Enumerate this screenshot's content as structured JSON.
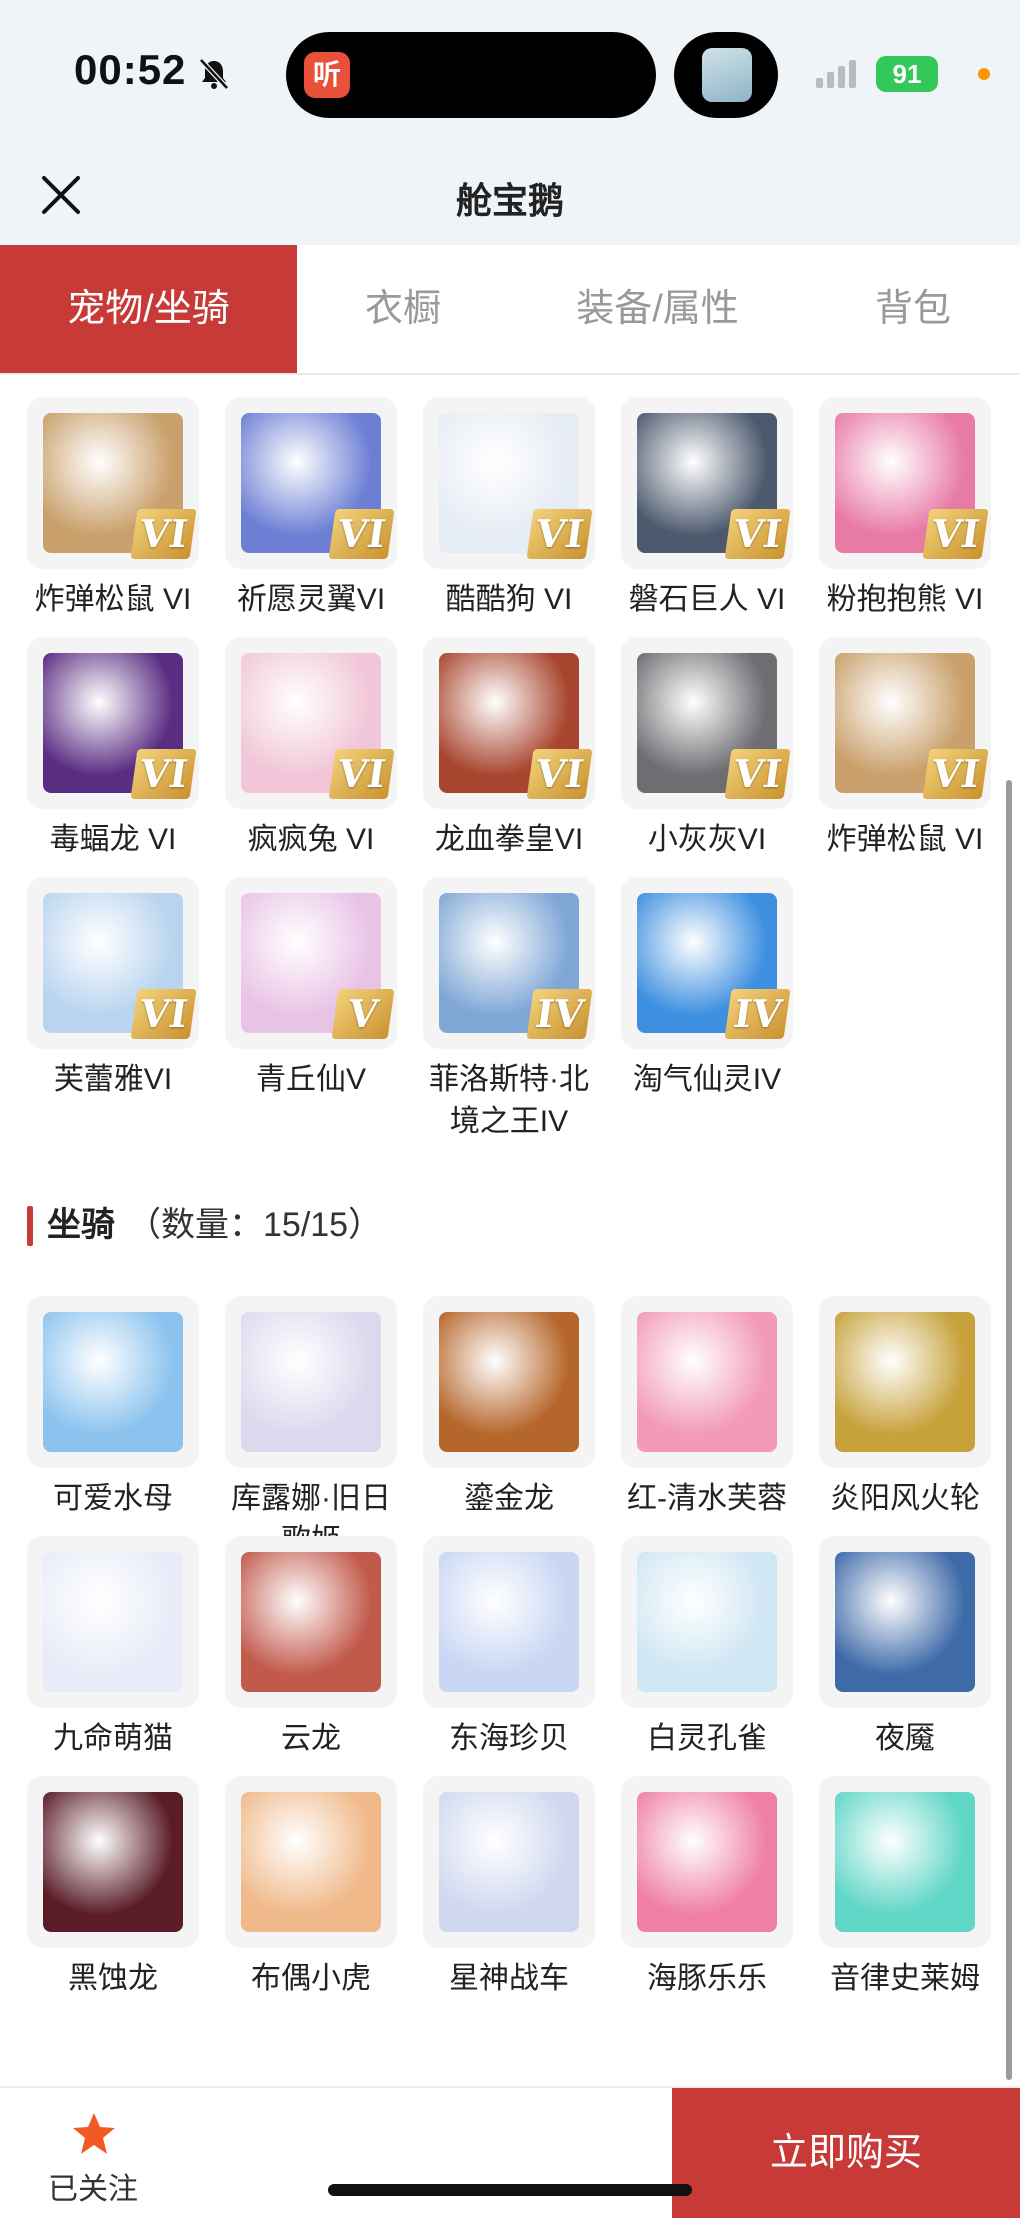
{
  "status": {
    "time": "00:52",
    "island_app": "听",
    "battery": "91"
  },
  "nav": {
    "title": "舱宝鹅"
  },
  "tabs": [
    {
      "label": "宠物/坐骑"
    },
    {
      "label": "衣橱"
    },
    {
      "label": "装备/属性"
    },
    {
      "label": "背包"
    }
  ],
  "pets": [
    {
      "name": "炸弹松鼠 VI",
      "badge": "VI",
      "color": "#c9a06b"
    },
    {
      "name": "祈愿灵翼VI",
      "badge": "VI",
      "color": "#6c7fd4"
    },
    {
      "name": "酷酷狗 VI",
      "badge": "VI",
      "color": "#e6ecf4"
    },
    {
      "name": "磐石巨人 VI",
      "badge": "VI",
      "color": "#4d5a6e"
    },
    {
      "name": "粉抱抱熊 VI",
      "badge": "VI",
      "color": "#e87aa6"
    },
    {
      "name": "毒蝠龙 VI",
      "badge": "VI",
      "color": "#5a2d82"
    },
    {
      "name": "疯疯兔 VI",
      "badge": "VI",
      "color": "#f2c6d8"
    },
    {
      "name": "龙血拳皇VI",
      "badge": "VI",
      "color": "#a8452e"
    },
    {
      "name": "小灰灰VI",
      "badge": "VI",
      "color": "#6d6d72"
    },
    {
      "name": "炸弹松鼠 VI",
      "badge": "VI",
      "color": "#c9a06b"
    },
    {
      "name": "芙蕾雅VI",
      "badge": "VI",
      "color": "#b9d4ef"
    },
    {
      "name": "青丘仙V",
      "badge": "V",
      "color": "#e9c3e6"
    },
    {
      "name": "菲洛斯特·北境之王IV",
      "badge": "IV",
      "color": "#7fa7d6"
    },
    {
      "name": "淘气仙灵IV",
      "badge": "IV",
      "color": "#3d8fe0"
    }
  ],
  "mounts_section": {
    "title": "坐骑",
    "count": "（数量：15/15）"
  },
  "mounts": [
    {
      "name": "可爱水母",
      "color": "#8cc3ee"
    },
    {
      "name": "库露娜·旧日歌姬",
      "color": "#dcd9ee"
    },
    {
      "name": "鎏金龙",
      "color": "#b5662a"
    },
    {
      "name": "红-清水芙蓉",
      "color": "#f29ab8"
    },
    {
      "name": "炎阳风火轮",
      "color": "#c7a23b"
    },
    {
      "name": "九命萌猫",
      "color": "#e8ecf8"
    },
    {
      "name": "云龙",
      "color": "#c25a4c"
    },
    {
      "name": "东海珍贝",
      "color": "#c9d6f4"
    },
    {
      "name": "白灵孔雀",
      "color": "#cfe6f3"
    },
    {
      "name": "夜魇",
      "color": "#3e6aa8"
    },
    {
      "name": "黑蚀龙",
      "color": "#5a1d28"
    },
    {
      "name": "布偶小虎",
      "color": "#f0b98a"
    },
    {
      "name": "星神战车",
      "color": "#cfd8ef"
    },
    {
      "name": "海豚乐乐",
      "color": "#ef7fa6"
    },
    {
      "name": "音律史莱姆",
      "color": "#5fd6c6"
    }
  ],
  "bottom": {
    "follow_label": "已关注",
    "buy_label": "立即购买"
  }
}
